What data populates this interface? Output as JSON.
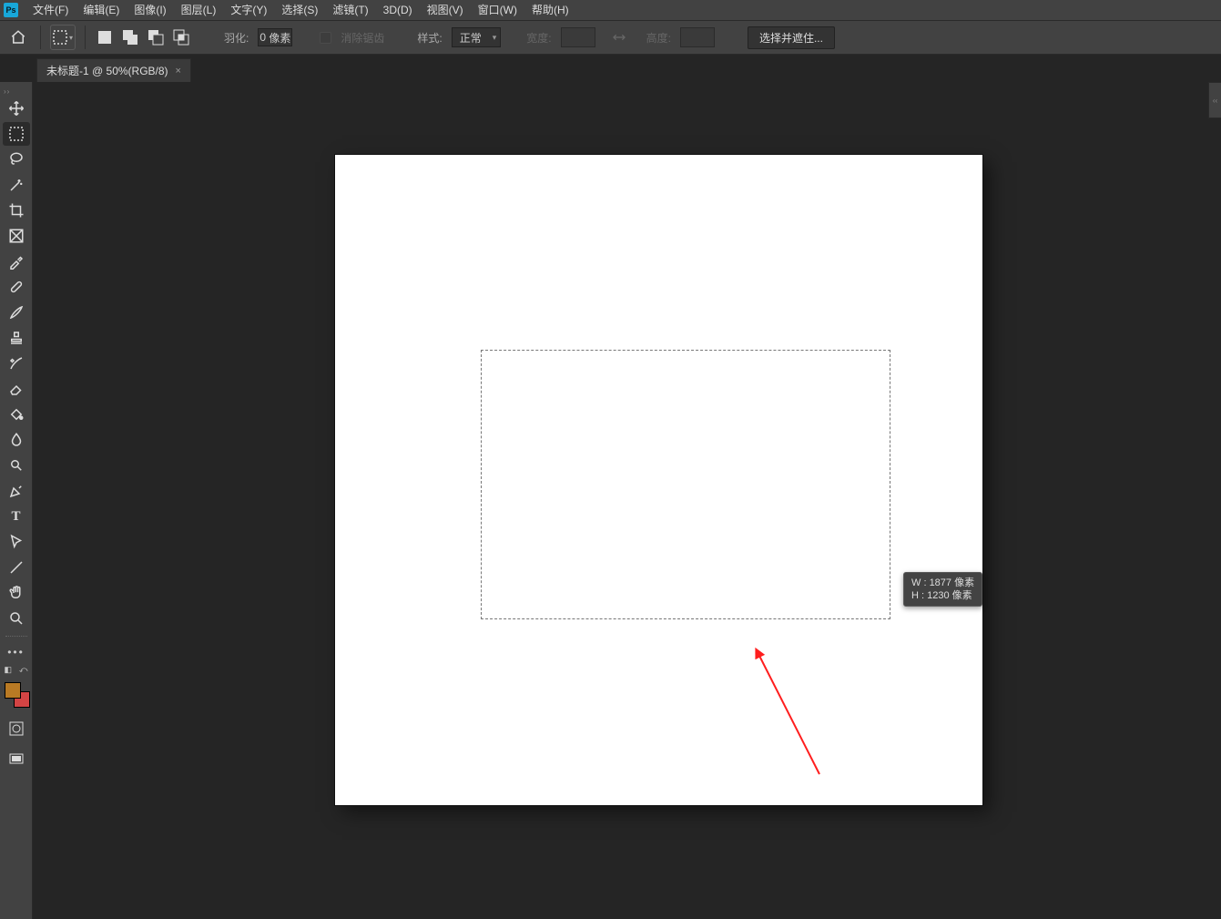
{
  "menu": {
    "file": "文件(F)",
    "edit": "编辑(E)",
    "image": "图像(I)",
    "layer": "图层(L)",
    "type": "文字(Y)",
    "select": "选择(S)",
    "filter": "滤镜(T)",
    "three_d": "3D(D)",
    "view": "视图(V)",
    "window": "窗口(W)",
    "help": "帮助(H)"
  },
  "options": {
    "feather_label": "羽化:",
    "feather_value": "0",
    "feather_unit": "像素",
    "antialias": "消除锯齿",
    "style_label": "样式:",
    "style_value": "正常",
    "width_label": "宽度:",
    "height_label": "高度:",
    "select_mask": "选择并遮住..."
  },
  "tab": {
    "title": "未标题-1 @ 50%(RGB/8)",
    "close": "×"
  },
  "selection_tip": {
    "w_label": "W :",
    "w_value": "1877",
    "h_label": "H :",
    "h_value": "1230",
    "unit": "像素"
  },
  "app_logo": "Ps"
}
